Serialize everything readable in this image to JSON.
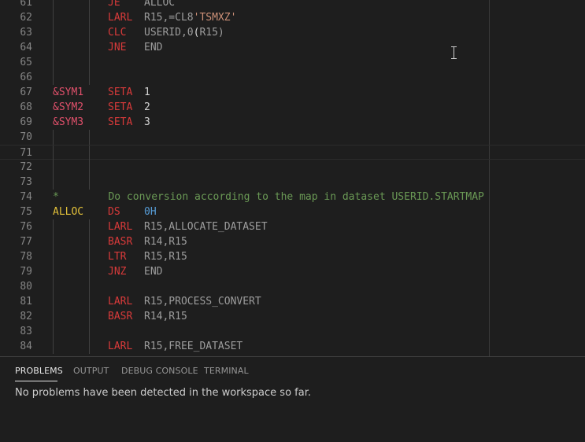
{
  "editor": {
    "lines": [
      {
        "num": "61",
        "cols": {
          "op": "JE",
          "operand": "ALLOC"
        }
      },
      {
        "num": "62",
        "cols": {
          "op": "LARL",
          "operand": "R15,=CL8'TSMXZ'"
        }
      },
      {
        "num": "63",
        "cols": {
          "op": "CLC",
          "operand": "USERID,0(R15)"
        }
      },
      {
        "num": "64",
        "cols": {
          "op": "JNE",
          "operand": "END"
        }
      },
      {
        "num": "65",
        "cols": {}
      },
      {
        "num": "66",
        "cols": {}
      },
      {
        "num": "67",
        "cols": {
          "label": "&SYM1",
          "op": "SETA",
          "operand": "1"
        }
      },
      {
        "num": "68",
        "cols": {
          "label": "&SYM2",
          "op": "SETA",
          "operand": "2"
        }
      },
      {
        "num": "69",
        "cols": {
          "label": "&SYM3",
          "op": "SETA",
          "operand": "3"
        }
      },
      {
        "num": "70",
        "cols": {}
      },
      {
        "num": "71",
        "cols": {}
      },
      {
        "num": "72",
        "cols": {}
      },
      {
        "num": "73",
        "cols": {}
      },
      {
        "num": "74",
        "cols": {
          "comment": "*        Do conversion according to the map in dataset USERID.STARTMAP"
        }
      },
      {
        "num": "75",
        "cols": {
          "label": "ALLOC",
          "op": "DS",
          "operand": "0H"
        }
      },
      {
        "num": "76",
        "cols": {
          "op": "LARL",
          "operand": "R15,ALLOCATE_DATASET"
        }
      },
      {
        "num": "77",
        "cols": {
          "op": "BASR",
          "operand": "R14,R15"
        }
      },
      {
        "num": "78",
        "cols": {
          "op": "LTR",
          "operand": "R15,R15"
        }
      },
      {
        "num": "79",
        "cols": {
          "op": "JNZ",
          "operand": "END"
        }
      },
      {
        "num": "80",
        "cols": {}
      },
      {
        "num": "81",
        "cols": {
          "op": "LARL",
          "operand": "R15,PROCESS_CONVERT"
        }
      },
      {
        "num": "82",
        "cols": {
          "op": "BASR",
          "operand": "R14,R15"
        }
      },
      {
        "num": "83",
        "cols": {}
      },
      {
        "num": "84",
        "cols": {
          "op": "LARL",
          "operand": "R15,FREE_DATASET"
        }
      }
    ]
  },
  "panel": {
    "tabs": [
      {
        "label": "PROBLEMS",
        "active": true
      },
      {
        "label": "OUTPUT",
        "active": false
      },
      {
        "label": "DEBUG CONSOLE",
        "active": false
      },
      {
        "label": "TERMINAL",
        "active": false
      }
    ],
    "message": "No problems have been detected in the workspace so far."
  },
  "colors": {
    "background": "#1e1e1e",
    "keyword": "#d83a3a",
    "label": "#e3c13a",
    "symbol": "#e0506b",
    "comment": "#6a9955",
    "string": "#ce9178"
  },
  "icons": [
    "text-cursor-icon"
  ]
}
